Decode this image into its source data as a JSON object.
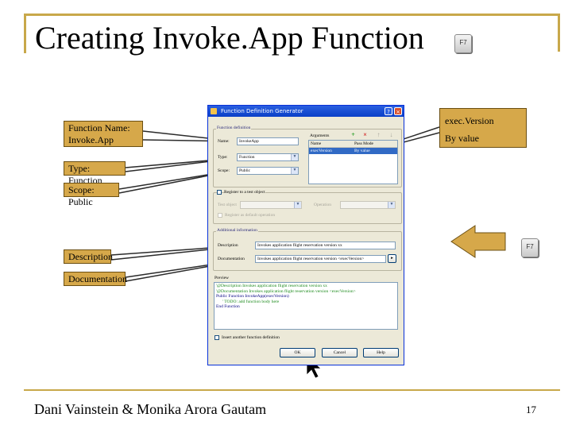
{
  "slide": {
    "title": "Creating Invoke.App Function",
    "key_label": "F7",
    "footer_author": "Dani Vainstein & Monika Arora Gautam",
    "page_number": "17"
  },
  "callouts": {
    "function_name": [
      "Function Name:",
      "Invoke.App"
    ],
    "type": "Type: Function",
    "scope": "Scope: Public",
    "description": "Description",
    "documentation": "Documentation",
    "argument_name": "exec.Version",
    "argument_pass": "By value"
  },
  "dialog": {
    "title": "Function Definition Generator",
    "function_definition_label": "Function definition",
    "name_label": "Name:",
    "name_value": "InvokeApp",
    "type_label": "Type:",
    "type_value": "Function",
    "scope_label": "Scope:",
    "scope_value": "Public",
    "arguments_label": "Arguments",
    "arg_columns": [
      "Name",
      "Pass Mode"
    ],
    "arg_rows": [
      [
        "execVersion",
        "By value"
      ]
    ],
    "register_label": "Register to a test object",
    "test_object_label": "Test object",
    "test_object_value": "",
    "operation_label": "Operation",
    "register_default_label": "Register as default operation",
    "additional_label": "Additional information",
    "description_label": "Description",
    "description_value": "Invokes application flight reservation version xx",
    "documentation_label": "Documentation",
    "documentation_value": "Invokes application flight reservation version <execVersion>",
    "preview_label": "Preview",
    "preview_lines": [
      "'@Description Invokes application flight reservation version xx",
      "'@Documentation Invokes application flight reservation version <execVersion>",
      "Public Function InvokeApp(execVersion)",
      "    ' TODO: add function body here",
      "End Function"
    ],
    "insert_another_label": "Insert another function definition",
    "ok_label": "OK",
    "cancel_label": "Cancel",
    "help_label": "Help"
  },
  "colors": {
    "callout_fill": "#d6a84a",
    "frame_gold": "#c8a84a",
    "titlebar_blue": "#0a3fc7",
    "selection_blue": "#316ac5"
  }
}
